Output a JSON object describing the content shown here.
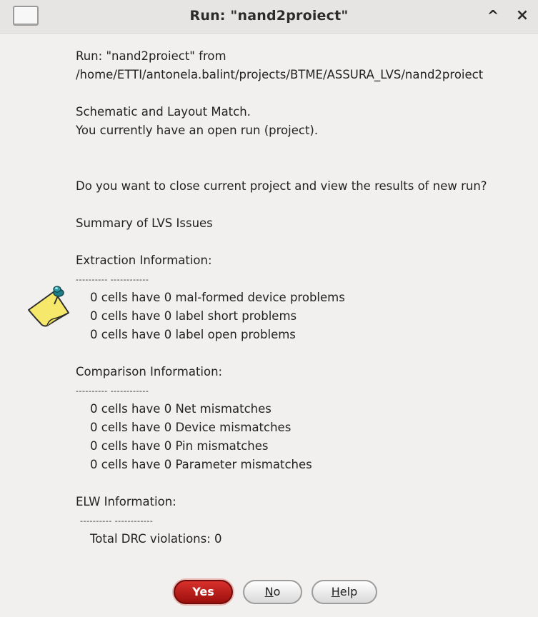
{
  "window": {
    "title": "Run: \"nand2proiect\"",
    "maximize_glyph": "^",
    "close_glyph": "×"
  },
  "message": {
    "run_line": "Run: \"nand2proiect\"  from",
    "path": "/home/ETTI/antonela.balint/projects/BTME/ASSURA_LVS/nand2proiect",
    "match": "Schematic and Layout Match.",
    "open_run": "You currently have an open run (project).",
    "question": "Do you want to close current project and view the results of new run?",
    "summary": "Summary of LVS Issues",
    "extraction": {
      "heading": "Extraction Information:",
      "separator": "---------- ------------",
      "items": [
        "0 cells have 0 mal-formed device problems",
        "0 cells have 0 label short problems",
        "0 cells have 0 label open problems"
      ]
    },
    "comparison": {
      "heading": "Comparison Information:",
      "separator": "---------- ------------",
      "items": [
        "0 cells have 0 Net mismatches",
        "0 cells have 0 Device mismatches",
        "0 cells have 0 Pin mismatches",
        "0 cells have 0 Parameter mismatches"
      ]
    },
    "elw": {
      "heading": "ELW Information:",
      "separator": "---------- ------------",
      "total": "Total DRC violations: 0"
    }
  },
  "buttons": {
    "yes": "Yes",
    "no_first": "N",
    "no_rest": "o",
    "help_first": "H",
    "help_rest": "elp"
  },
  "icons": {
    "system_menu": "window-menu-icon",
    "note": "pinned-note-icon"
  }
}
